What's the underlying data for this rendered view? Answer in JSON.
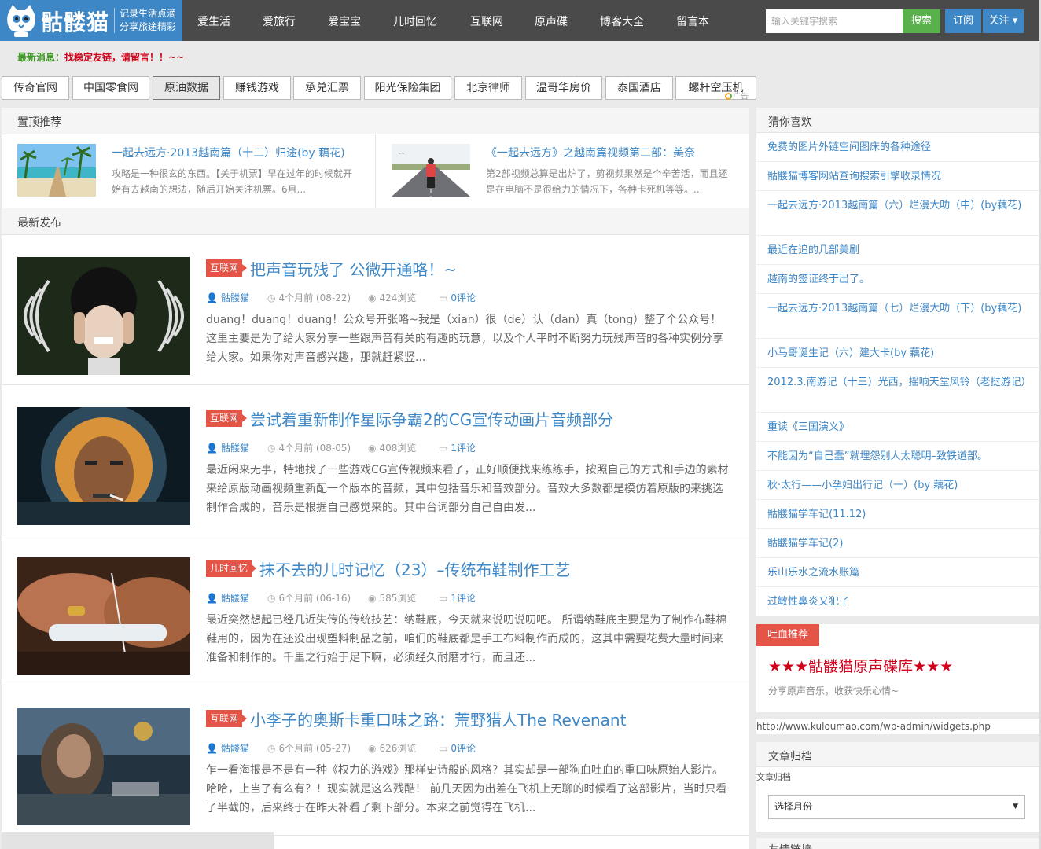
{
  "header": {
    "logo_name": "骷髅猫",
    "slogan_1": "记录生活点滴",
    "slogan_2": "分享旅途精彩",
    "nav": [
      "爱生活",
      "爱旅行",
      "爱宝宝",
      "儿时回忆",
      "互联网",
      "原声碟",
      "博客大全",
      "留言本"
    ],
    "search_placeholder": "输入关键字搜索",
    "search_btn": "搜索",
    "subscribe_btn": "订阅",
    "follow_btn": "关注 ▾"
  },
  "ticker": {
    "label": "最新消息：",
    "message": "找稳定友链，请留言！！~~"
  },
  "ad_tabs": [
    "传奇官网",
    "中国零食网",
    "原油数据",
    "赚钱游戏",
    "承兑汇票",
    "阳光保险集团",
    "北京律师",
    "温哥华房价",
    "泰国酒店",
    "螺杆空压机"
  ],
  "ad_mark": "广告",
  "pinned": {
    "heading": "置顶推荐",
    "items": [
      {
        "title": "一起去远方·2013越南篇（十二）归途(by 藕花)",
        "excerpt": "攻略是一种很玄的东西。【关于机票】早在过年的时候就开始有去越南的想法，随后开始关注机票。6月..."
      },
      {
        "title": "《一起去远方》之越南篇视频第二部：美奈",
        "excerpt": "第2部视频总算是出炉了，剪视频果然是个辛苦活，而且还是在电脑不是很给力的情况下，各种卡死机等等。..."
      }
    ]
  },
  "latest": {
    "heading": "最新发布",
    "posts": [
      {
        "category": "互联网",
        "title": "把声音玩残了 公微开通咯！~",
        "author": "骷髅猫",
        "time": "4个月前 (08-22)",
        "views": "424浏览",
        "comments": "0评论",
        "excerpt": "duang！duang！duang！公众号开张咯~我是（xian）很（de）认（dan）真（tong）整了个公众号！ 这里主要是为了给大家分享一些跟声音有关的有趣的玩意，以及个人平时不断努力玩残声音的各种实例分享给大家。如果你对声音感兴趣，那就赶紧竖..."
      },
      {
        "category": "互联网",
        "title": "尝试着重新制作星际争霸2的CG宣传动画片音频部分",
        "author": "骷髅猫",
        "time": "4个月前 (08-05)",
        "views": "408浏览",
        "comments": "1评论",
        "excerpt": "最近闲来无事，特地找了一些游戏CG宣传视频来看了，正好顺便找来练练手，按照自己的方式和手边的素材来给原版动画视频重新配一个版本的音频，其中包括音乐和音效部分。音效大多数都是模仿着原版的来挑选制作合成的，音乐是根据自己感觉来的。其中台词部分自己自由发..."
      },
      {
        "category": "儿时回忆",
        "title": "抹不去的儿时记忆（23）–传统布鞋制作工艺",
        "author": "骷髅猫",
        "time": "6个月前 (06-16)",
        "views": "585浏览",
        "comments": "1评论",
        "excerpt": "最近突然想起已经几近失传的传统技艺：纳鞋底，今天就来说叨说叨吧。 所谓纳鞋底主要是为了制作布鞋棉鞋用的，因为在还没出现塑料制品之前，咱们的鞋底都是手工布料制作而成的，这其中需要花费大量时间来准备和制作的。千里之行始于足下嘛，必须经久耐磨才行，而且还..."
      },
      {
        "category": "互联网",
        "title": "小李子的奥斯卡重口味之路：荒野猎人The Revenant",
        "author": "骷髅猫",
        "time": "6个月前 (05-27)",
        "views": "626浏览",
        "comments": "0评论",
        "excerpt": "乍一看海报是不是有一种《权力的游戏》那样史诗般的风格？其实却是一部狗血吐血的重口味原始人影片。哈哈，上当了有么有？！现实就是这么残酷！ 前几天因为出差在飞机上无聊的时候看了这部影片，当时只看了半截的，后来终于在昨天补看了剩下部分。本来之前觉得在飞机..."
      }
    ]
  },
  "sidebar": {
    "guess_heading": "猜你喜欢",
    "guess_items": [
      "免费的图片外链空间图床的各种途径",
      "骷髅猫博客网站查询搜索引擎收录情况",
      "一起去远方·2013越南篇（六）烂漫大叻（中）(by藕花)",
      "最近在追的几部美剧",
      "越南的签证终于出了。",
      "一起去远方·2013越南篇（七）烂漫大叻（下）(by藕花)",
      "小马哥诞生记（六）建大卡(by 藕花)",
      "2012.3.南游记（十三）光西，摇响天堂风铃（老挝游记）",
      "重读《三国演义》",
      "不能因为“自己蠢”就埋怨别人太聪明–致铁道部。",
      "秋·太行——小孕妇出行记（一）(by 藕花)",
      "骷髅猫学车记(11.12)",
      "骷髅猫学车记(2)",
      "乐山乐水之流水账篇",
      "过敏性鼻炎又犯了"
    ],
    "hot_tag": "吐血推荐",
    "hot_title": "★★★骷髅猫原声碟库★★★",
    "hot_desc": "分享原声音乐，收获快乐心情~",
    "widget_url": "http://www.kuloumao.com/wp-admin/widgets.php",
    "archive_heading": "文章归档",
    "archive_sub": "文章归档",
    "archive_select": "选择月份",
    "links_heading": "友情链接"
  }
}
